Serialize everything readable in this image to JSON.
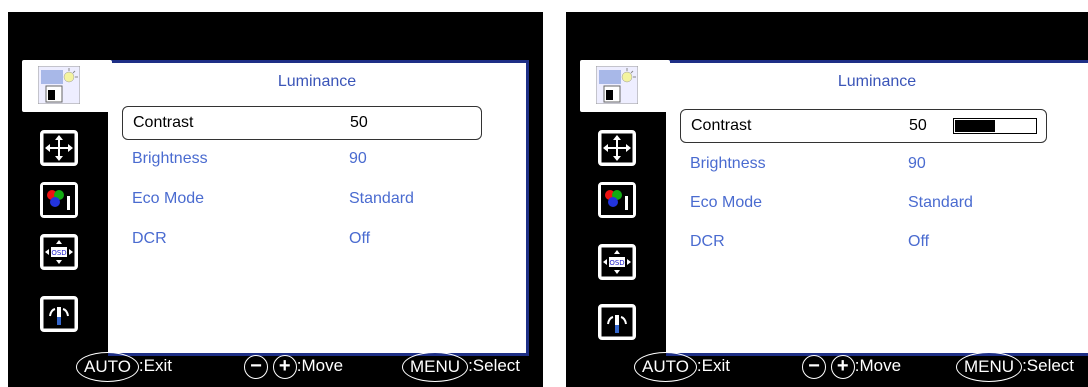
{
  "panel_title": "Luminance",
  "menu_items": [
    {
      "label": "Contrast",
      "value": "50"
    },
    {
      "label": "Brightness",
      "value": "90"
    },
    {
      "label": "Eco Mode",
      "value": "Standard"
    },
    {
      "label": "DCR",
      "value": "Off"
    }
  ],
  "contrast_level_fraction": 0.5,
  "sidebar_icons": [
    "luminance-icon",
    "image-setup-icon",
    "color-temp-icon",
    "osd-setup-icon",
    "extra-icon"
  ],
  "footer": {
    "auto_key": "AUTO",
    "auto_action": ":Exit",
    "minus_key": "−",
    "plus_key": "+",
    "move_action": ":Move",
    "menu_key": "MENU",
    "menu_action": ":Select"
  },
  "colors": {
    "accent_blue": "#4a6bd0",
    "panel_border": "#1e2f86"
  }
}
